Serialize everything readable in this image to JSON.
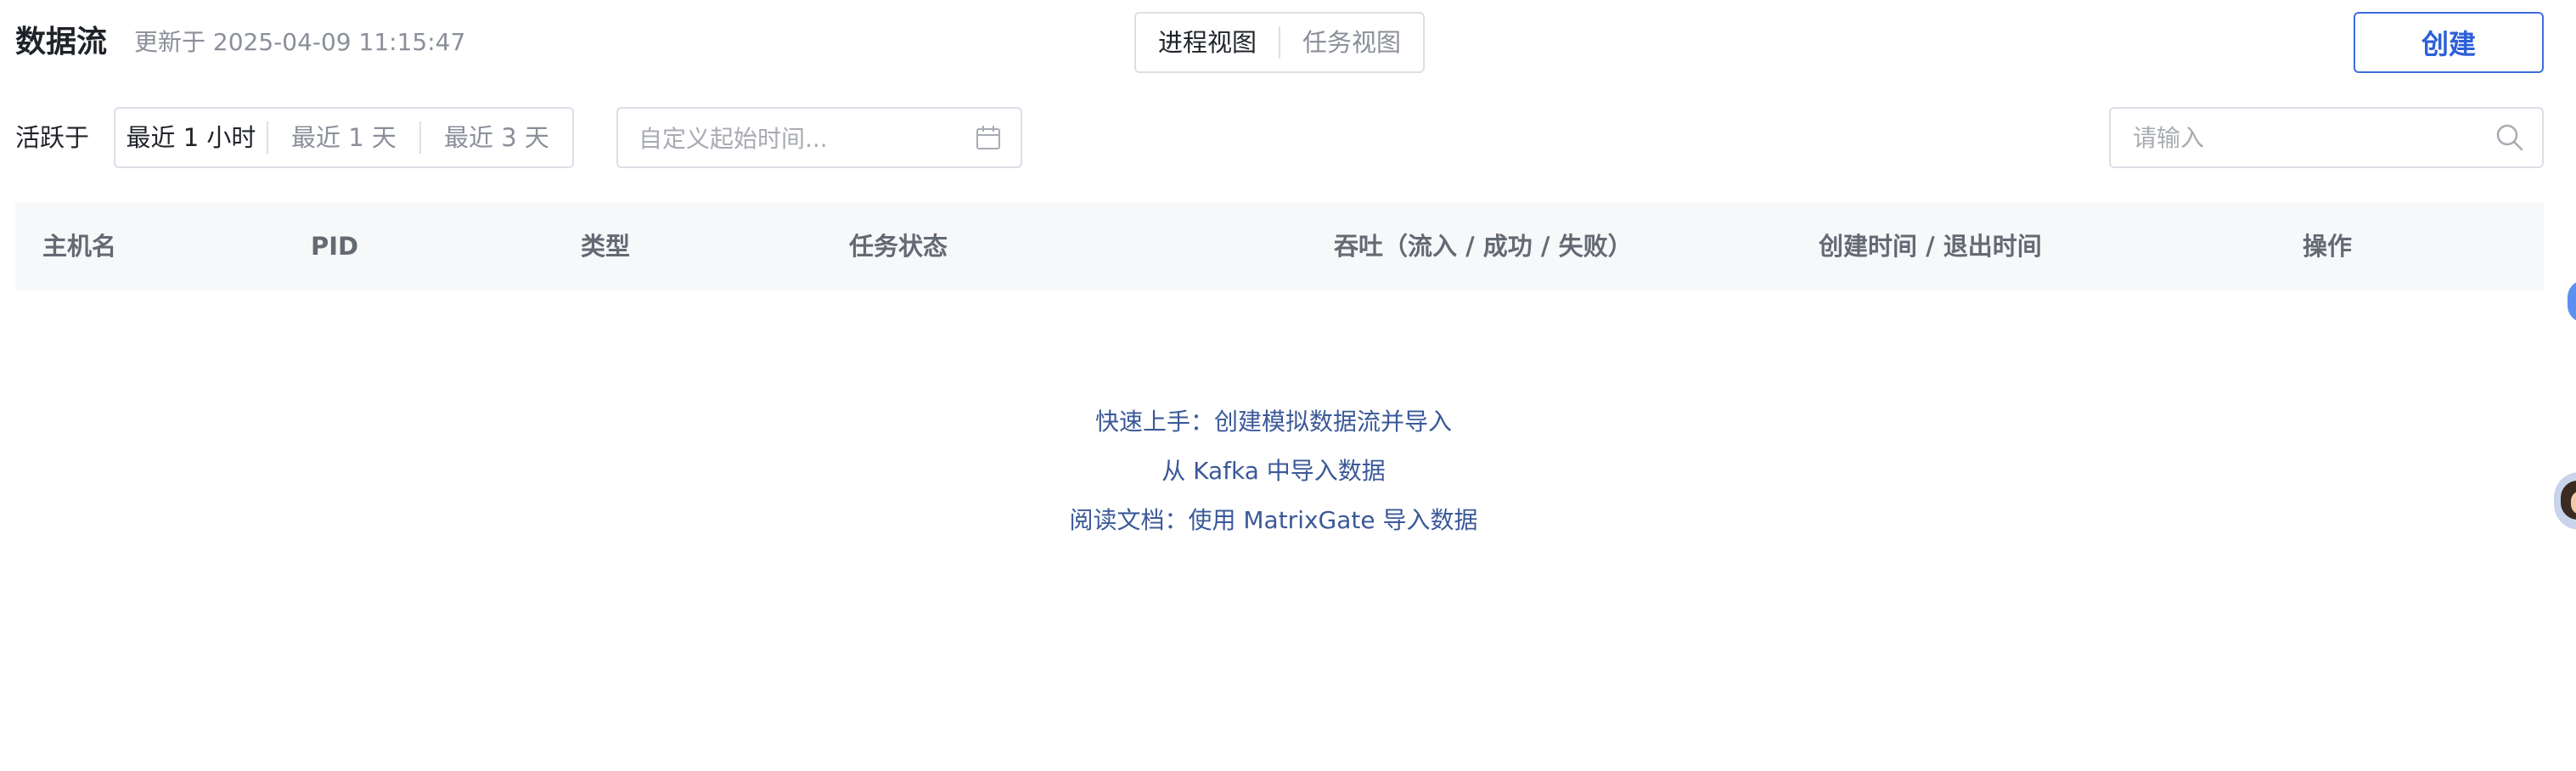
{
  "header": {
    "title": "数据流",
    "updated": "更新于 2025-04-09 11:15:47",
    "view_tabs": [
      {
        "label": "进程视图",
        "active": true
      },
      {
        "label": "任务视图",
        "active": false
      }
    ],
    "create_label": "创建"
  },
  "filters": {
    "active_label": "活跃于",
    "ranges": [
      {
        "label": "最近 1 小时",
        "active": true
      },
      {
        "label": "最近 1 天",
        "active": false
      },
      {
        "label": "最近 3 天",
        "active": false
      }
    ],
    "date_placeholder": "自定义起始时间...",
    "search_placeholder": "请输入",
    "search_value": ""
  },
  "table": {
    "columns": [
      "主机名",
      "PID",
      "类型",
      "任务状态",
      "吞吐（流入 / 成功 / 失败）",
      "创建时间 / 退出时间",
      "操作"
    ],
    "rows": []
  },
  "empty_state": {
    "links": [
      "快速上手：创建模拟数据流并导入",
      "从 Kafka 中导入数据",
      "阅读文档：使用 MatrixGate 导入数据"
    ]
  },
  "colors": {
    "accent": "#2d5fd8",
    "link": "#3b5998",
    "muted_text": "#8a8f99",
    "header_bg": "#f7f8fa",
    "border": "#dcdfe6"
  },
  "icons": {
    "date": "calendar-icon",
    "search": "search-icon"
  }
}
